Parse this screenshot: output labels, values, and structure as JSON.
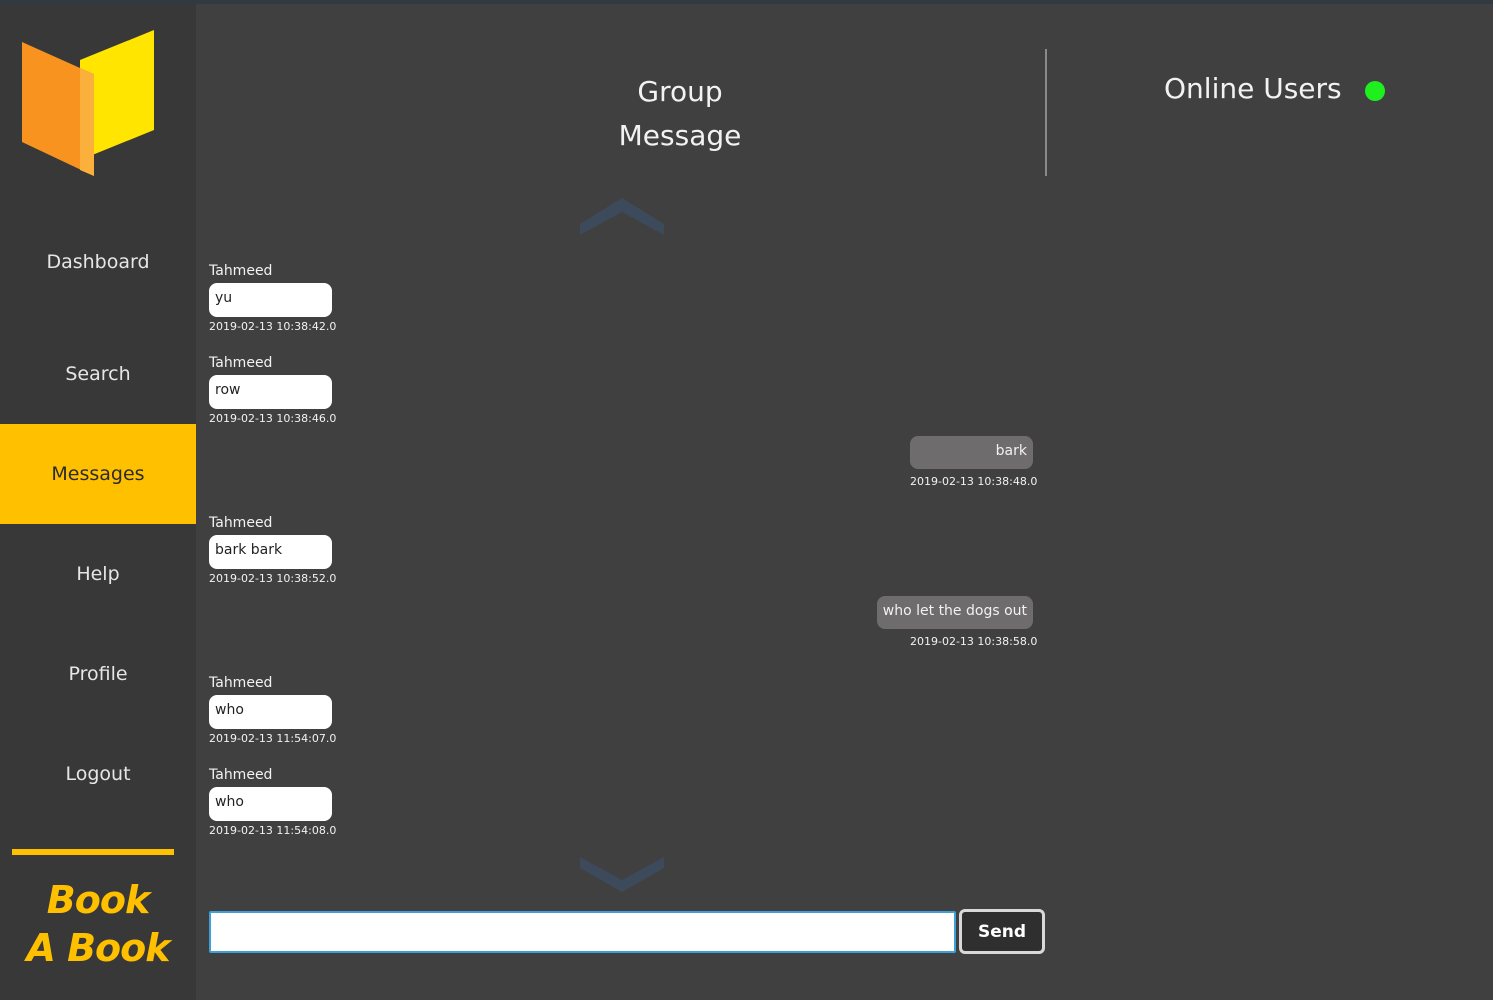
{
  "sidebar": {
    "items": [
      {
        "label": "Dashboard",
        "active": false
      },
      {
        "label": "Search",
        "active": false
      },
      {
        "label": "Messages",
        "active": true
      },
      {
        "label": "Help",
        "active": false
      },
      {
        "label": "Profile",
        "active": false
      },
      {
        "label": "Logout",
        "active": false
      }
    ],
    "brand_line1": "Book",
    "brand_line2": "A Book"
  },
  "header": {
    "title_line1": "Group",
    "title_line2": "Message",
    "online_title": "Online Users",
    "online_status_color": "#1fee1f"
  },
  "messages": [
    {
      "sender": "Tahmeed",
      "text": "yu",
      "timestamp": "2019-02-13 10:38:42.0",
      "outgoing": false
    },
    {
      "sender": "Tahmeed",
      "text": "row",
      "timestamp": "2019-02-13 10:38:46.0",
      "outgoing": false
    },
    {
      "sender": "",
      "text": "bark",
      "timestamp": "2019-02-13 10:38:48.0",
      "outgoing": true
    },
    {
      "sender": "Tahmeed",
      "text": "bark bark",
      "timestamp": "2019-02-13 10:38:52.0",
      "outgoing": false
    },
    {
      "sender": "",
      "text": "who let the dogs out",
      "timestamp": "2019-02-13 10:38:58.0",
      "outgoing": true
    },
    {
      "sender": "Tahmeed",
      "text": "who",
      "timestamp": "2019-02-13 11:54:07.0",
      "outgoing": false
    },
    {
      "sender": "Tahmeed",
      "text": "who",
      "timestamp": "2019-02-13 11:54:08.0",
      "outgoing": false
    }
  ],
  "composer": {
    "value": "",
    "send_label": "Send"
  },
  "icons": {
    "scroll_up": "chevron-up-icon",
    "scroll_down": "chevron-down-icon",
    "logo": "open-book-logo"
  },
  "colors": {
    "accent": "#ffc000",
    "background": "#404040",
    "sidebar": "#383838",
    "chevron": "#3d4a5c",
    "outgoing_bubble": "#6e6c6c"
  }
}
